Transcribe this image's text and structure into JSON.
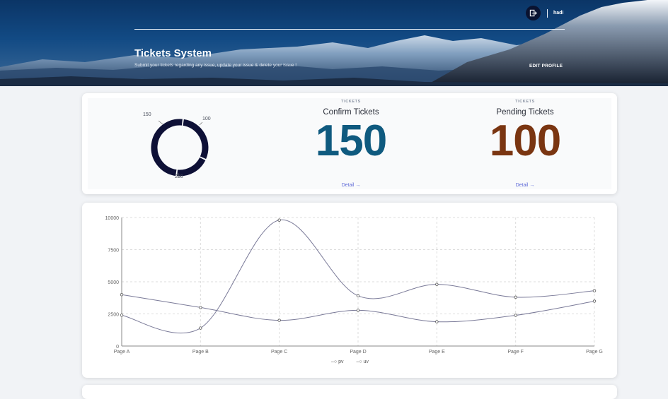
{
  "header": {
    "title": "Tickets System",
    "subtitle": "Submit your tickets regarding any issue, update your issue & delete your issue !",
    "edit_profile": "EDIT PROFILE",
    "username": "hadi",
    "logout_icon": "logout-icon"
  },
  "stats": {
    "donut": {
      "labels": [
        "150",
        "100",
        "250"
      ],
      "color": "#0e1036"
    },
    "confirm": {
      "kicker": "TICKETS",
      "label": "Confirm Tickets",
      "value": "150",
      "color": "#0f5a7f",
      "detail": "Detail"
    },
    "pending": {
      "kicker": "TICKETS",
      "label": "Pending Tickets",
      "value": "100",
      "color": "#7a3511",
      "detail": "Detail"
    }
  },
  "chart_data": {
    "type": "line",
    "categories": [
      "Page A",
      "Page B",
      "Page C",
      "Page D",
      "Page E",
      "Page F",
      "Page G"
    ],
    "series": [
      {
        "name": "pv",
        "values": [
          2400,
          1398,
          9800,
          3908,
          4800,
          3800,
          4300
        ]
      },
      {
        "name": "uv",
        "values": [
          4000,
          3000,
          2000,
          2780,
          1890,
          2390,
          3490
        ]
      }
    ],
    "yticks": [
      "0",
      "2500",
      "5000",
      "7500",
      "10000"
    ],
    "ylim": [
      0,
      10000
    ],
    "grid": true,
    "legend": "bottom-center"
  }
}
